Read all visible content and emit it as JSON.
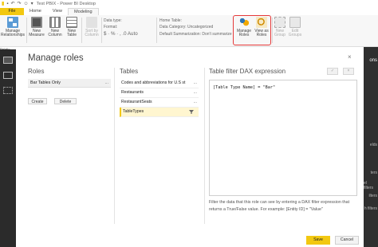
{
  "window": {
    "title": "Test PBIX - Power BI Desktop"
  },
  "ribbon_tabs": [
    "File",
    "Home",
    "View",
    "Modeling"
  ],
  "ribbon": {
    "manage_relationships": "Manage Relationships",
    "new_measure": "New Measure",
    "new_column": "New Column",
    "new_table": "New Table",
    "sort_by_column": "Sort by Column",
    "data_type": "Data type:",
    "format": "Format:",
    "currency_row": "$ · % · ,  .0  Auto",
    "home_table": "Home Table:",
    "data_category": "Data Category: Uncategorized",
    "default_summarization": "Default Summarization: Don't summarize",
    "manage_roles": "Manage Roles",
    "view_as_roles": "View as Roles",
    "new_group": "New Group",
    "edit_groups": "Edit Groups"
  },
  "left_fragment": "Relatio",
  "right_fragments": [
    "ons",
    "elds",
    "ters",
    "el filters",
    "ilters",
    "h filters"
  ],
  "dialog": {
    "title": "Manage roles",
    "close": "×",
    "roles_header": "Roles",
    "roles": [
      {
        "name": "Bar Tables Only",
        "more": "..."
      }
    ],
    "create_label": "Create",
    "delete_label": "Delete",
    "tables_header": "Tables",
    "tables": [
      {
        "name": "Codes and abbreviations for U.S st",
        "more": "..."
      },
      {
        "name": "Restaurants",
        "more": "..."
      },
      {
        "name": "RestaurantSeats",
        "more": "..."
      },
      {
        "name": "TableTypes",
        "more": ""
      }
    ],
    "dax_header": "Table filter DAX expression",
    "dax_check": "✓",
    "dax_cross": "×",
    "dax_expression": "[Table Type Name] = \"Bar\"",
    "help_text": "Filter the data that this role can see by entering a DAX filter expression that returns a True/False value. For example: [Entity ID] = \"Value\"",
    "save_label": "Save",
    "cancel_label": "Cancel"
  },
  "colors": {
    "accent": "#f2c811",
    "highlight": "#e53939",
    "dark_panel": "#2b2b2b"
  }
}
